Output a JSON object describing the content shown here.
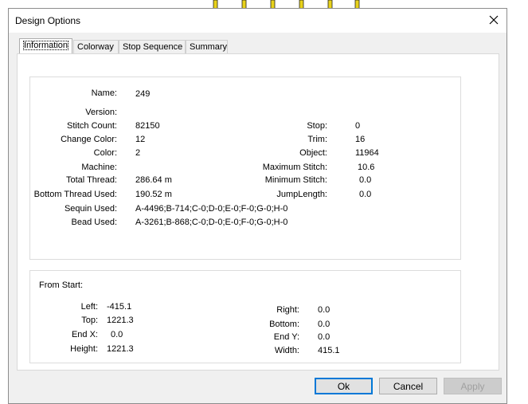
{
  "window": {
    "title": "Design Options"
  },
  "tabs": [
    "Information",
    "Colorway",
    "Stop Sequence",
    "Summary"
  ],
  "info": {
    "name_label": "Name:",
    "name_value": "249",
    "version_label": "Version:",
    "stitch_count_label": "Stitch Count:",
    "stitch_count_value": "82150",
    "change_color_label": "Change Color:",
    "change_color_value": "12",
    "color_label": "Color:",
    "color_value": "2",
    "machine_label": "Machine:",
    "total_thread_label": "Total Thread:",
    "total_thread_value": "286.64 m",
    "bottom_thread_label": "Bottom Thread Used:",
    "bottom_thread_value": "190.52 m",
    "sequin_label": "Sequin Used:",
    "sequin_value": "A-4496;B-714;C-0;D-0;E-0;F-0;G-0;H-0",
    "bead_label": "Bead Used:",
    "bead_value": "A-3261;B-868;C-0;D-0;E-0;F-0;G-0;H-0",
    "stop_label": "Stop:",
    "stop_value": "0",
    "trim_label": "Trim:",
    "trim_value": "16",
    "object_label": "Object:",
    "object_value": "11964",
    "max_stitch_label": "Maximum Stitch:",
    "max_stitch_value": "10.6",
    "min_stitch_label": "Minimum Stitch:",
    "min_stitch_value": "0.0",
    "jump_length_label": "JumpLength:",
    "jump_length_value": "0.0"
  },
  "from_start": {
    "title": "From Start:",
    "left_label": "Left:",
    "left_value": "-415.1",
    "top_label": "Top:",
    "top_value": "1221.3",
    "end_x_label": "End X:",
    "end_x_value": "0.0",
    "height_label": "Height:",
    "height_value": "1221.3",
    "right_label": "Right:",
    "right_value": "0.0",
    "bottom_label": "Bottom:",
    "bottom_value": "0.0",
    "end_y_label": "End Y:",
    "end_y_value": "0.0",
    "width_label": "Width:",
    "width_value": "415.1"
  },
  "buttons": {
    "ok": "Ok",
    "cancel": "Cancel",
    "apply": "Apply"
  },
  "colors": {
    "accent": "#0078d7",
    "stitch": "#e8d21a"
  }
}
